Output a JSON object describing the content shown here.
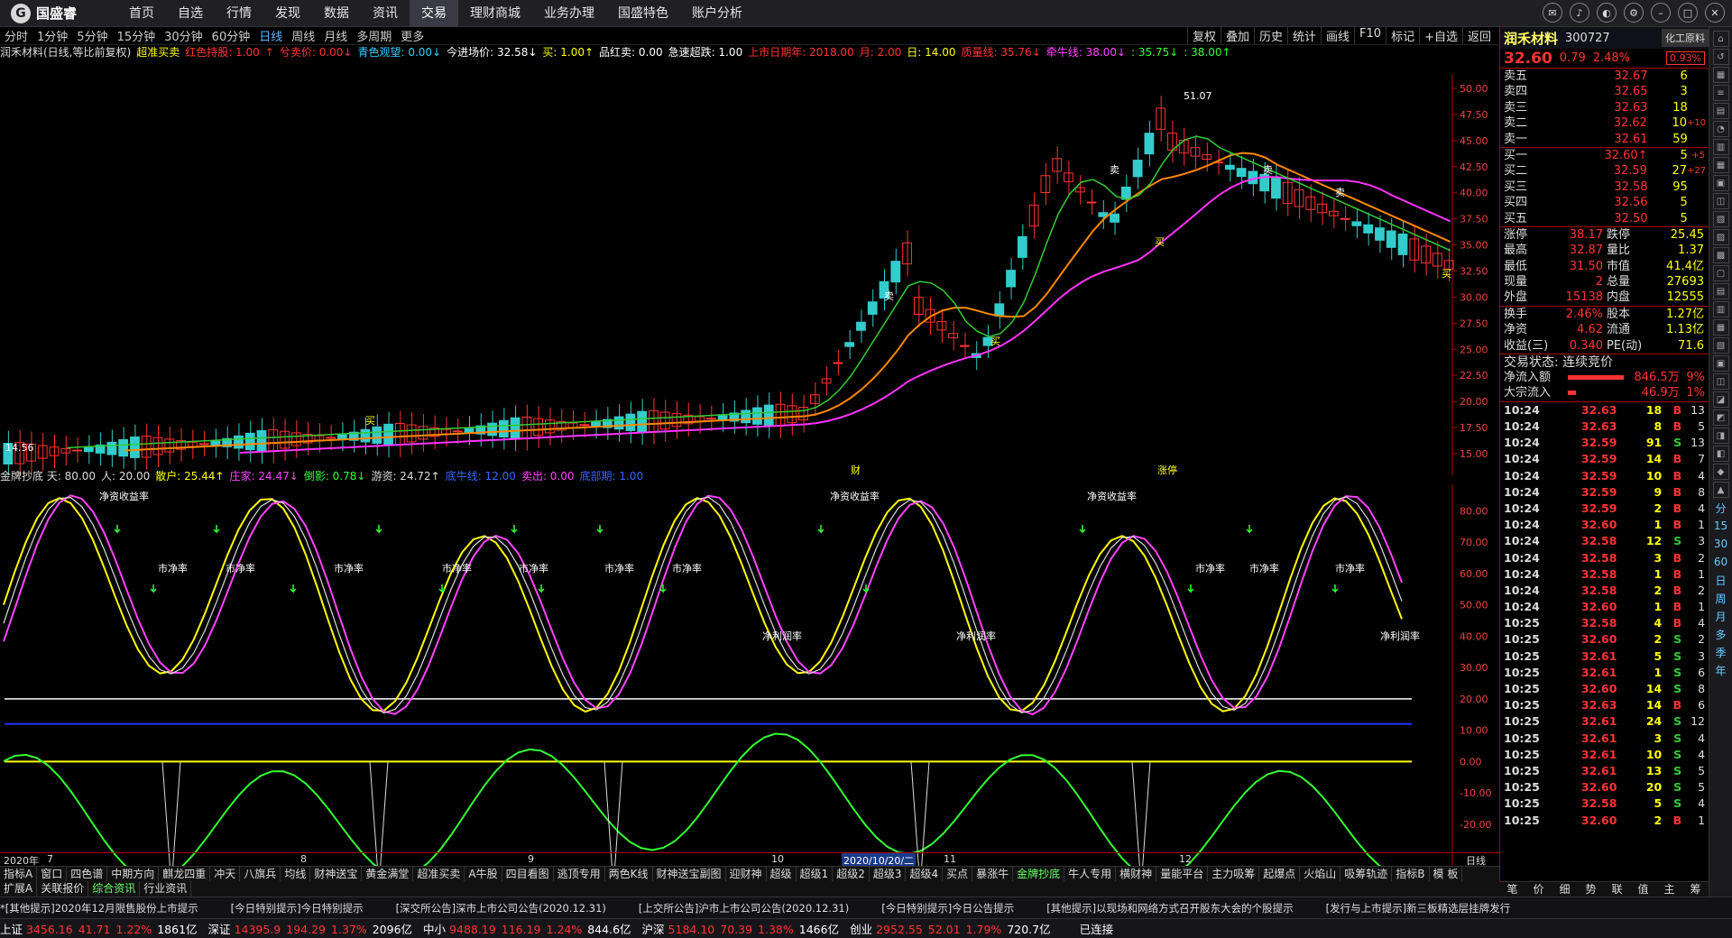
{
  "app": {
    "logo": "国盛睿",
    "nav": [
      "首页",
      "自选",
      "行情",
      "发现",
      "数据",
      "资讯",
      "交易",
      "理财商城",
      "业务办理",
      "国盛特色",
      "账户分析"
    ],
    "active_nav": "交易"
  },
  "periods": [
    "分时",
    "1分钟",
    "5分钟",
    "15分钟",
    "30分钟",
    "60分钟",
    "日线",
    "周线",
    "月线",
    "多周期",
    "更多"
  ],
  "active_period": "日线",
  "tools": [
    "复权",
    "叠加",
    "历史",
    "统计",
    "画线",
    "F10",
    "标记",
    "+自选",
    "返回"
  ],
  "main_indicator": {
    "title": "润禾材料(日线,等比前复权)",
    "name": "超准买卖",
    "items": [
      {
        "t": "红色持股: 1.00",
        "c": "#ff3333"
      },
      {
        "t": "↑",
        "c": "#ff3333"
      },
      {
        "t": "兮卖价: 0.00↓",
        "c": "#ff3333"
      },
      {
        "t": "青色观望: 0.00↓",
        "c": "#33ccff"
      },
      {
        "t": "今进场价: 32.58↓",
        "c": "#ffffff"
      },
      {
        "t": "买: 1.00↑",
        "c": "#ffff00"
      },
      {
        "t": "品红卖: 0.00",
        "c": "#ffffff"
      },
      {
        "t": "急速超跌: 1.00",
        "c": "#ffffff"
      },
      {
        "t": "上市日期年: 2018.00",
        "c": "#ff3333"
      },
      {
        "t": "月: 2.00",
        "c": "#ff3333"
      },
      {
        "t": "日: 14.00",
        "c": "#ffff00"
      },
      {
        "t": "质量线: 35.76↓",
        "c": "#ff3333"
      },
      {
        "t": "牵牛线: 38.00↓",
        "c": "#ff44ff"
      },
      {
        "t": ": 35.75↓",
        "c": "#33ff33"
      },
      {
        "t": ": 38.00↑",
        "c": "#33ff33"
      }
    ]
  },
  "sub_indicator": {
    "items": [
      {
        "t": "金牌抄底 天: 80.00",
        "c": "#dddddd"
      },
      {
        "t": "人: 20.00",
        "c": "#dddddd"
      },
      {
        "t": "散户: 25.44↑",
        "c": "#ffff00"
      },
      {
        "t": "庄家: 24.47↓",
        "c": "#ff44ff"
      },
      {
        "t": "倒影: 0.78↓",
        "c": "#33ff33"
      },
      {
        "t": "游资: 24.72↑",
        "c": "#dddddd"
      },
      {
        "t": "底牛线: 12.00",
        "c": "#3366ff"
      },
      {
        "t": "卖出: 0.00",
        "c": "#ff44ff"
      },
      {
        "t": "底部期: 1.00",
        "c": "#3366ff"
      }
    ]
  },
  "price_axis": [
    "50.00",
    "47.50",
    "45.00",
    "42.50",
    "40.00",
    "37.50",
    "35.00",
    "32.50",
    "30.00",
    "27.50",
    "25.00",
    "22.50",
    "20.00",
    "17.50",
    "15.00"
  ],
  "sub_axis": [
    "80.00",
    "70.00",
    "60.00",
    "50.00",
    "40.00",
    "30.00",
    "20.00",
    "10.00",
    "0.00",
    "-10.00",
    "-20.00"
  ],
  "annotations": {
    "high": "51.07",
    "low": "14.56",
    "cai": "财",
    "zhangting": "涨停",
    "label_jzc": "净资收益率",
    "label_sjl": "市净率",
    "label_jlr": "净利润率",
    "buy": "买",
    "sell": "卖"
  },
  "date_axis": {
    "year": "2020年",
    "months": [
      "7",
      "8",
      "9",
      "10",
      "11",
      "12"
    ],
    "highlight": "2020/10/20/二",
    "label": "日线"
  },
  "tabs1": [
    "指标A",
    "窗口",
    "四色谱",
    "中期方向",
    "麒龙四重",
    "冲天",
    "八旗兵",
    "均线",
    "财神送宝",
    "黄金满堂",
    "超准买卖",
    "A牛股",
    "四目看图",
    "逃顶专用",
    "两色K线",
    "财神送宝副图",
    "迎财神",
    "超级",
    "超级1",
    "超级2",
    "超级3",
    "超级4",
    "买点",
    "暴涨牛",
    "金牌抄底",
    "牛人专用",
    "横财神",
    "量能平台",
    "主力吸筹",
    "起爆点",
    "火焰山",
    "吸筹轨迹",
    "指标B",
    "模 板"
  ],
  "tabs1_active": "金牌抄底",
  "tabs2": [
    "扩展A",
    "关联报价",
    "综合资讯",
    "行业资讯"
  ],
  "tabs2_active": "综合资讯",
  "right_panel": {
    "name": "润禾材料",
    "code": "300727",
    "sector": "化工原料",
    "sector_pct": "0.93%",
    "price": "32.60",
    "change": "0.79",
    "pct": "2.48%",
    "asks": [
      {
        "k": "卖五",
        "p": "32.67",
        "q": "6",
        "d": ""
      },
      {
        "k": "卖四",
        "p": "32.65",
        "q": "3",
        "d": ""
      },
      {
        "k": "卖三",
        "p": "32.63",
        "q": "18",
        "d": ""
      },
      {
        "k": "卖二",
        "p": "32.62",
        "q": "10",
        "d": "+10"
      },
      {
        "k": "卖一",
        "p": "32.61",
        "q": "59",
        "d": ""
      }
    ],
    "bids": [
      {
        "k": "买一",
        "p": "32.60↑",
        "q": "5",
        "d": "+5"
      },
      {
        "k": "买二",
        "p": "32.59",
        "q": "27",
        "d": "+27"
      },
      {
        "k": "买三",
        "p": "32.58",
        "q": "95",
        "d": ""
      },
      {
        "k": "买四",
        "p": "32.56",
        "q": "5",
        "d": ""
      },
      {
        "k": "买五",
        "p": "32.50",
        "q": "5",
        "d": ""
      }
    ],
    "stats": [
      [
        "涨停",
        "38.17",
        "跌停",
        "25.45"
      ],
      [
        "最高",
        "32.87",
        "量比",
        "1.37"
      ],
      [
        "最低",
        "31.50",
        "市值",
        "41.4亿"
      ],
      [
        "现量",
        "2",
        "总量",
        "27693"
      ],
      [
        "外盘",
        "15138",
        "内盘",
        "12555"
      ]
    ],
    "stats2": [
      [
        "换手",
        "2.46%",
        "股本",
        "1.27亿"
      ],
      [
        "净资",
        "4.62",
        "流通",
        "1.13亿"
      ],
      [
        "收益(三)",
        "0.340",
        "PE(动)",
        "71.6"
      ]
    ],
    "state": "交易状态: 连续竞价",
    "flow": [
      {
        "k": "净流入额",
        "v": "846.5万",
        "p": "9%"
      },
      {
        "k": "大宗流入",
        "v": "46.9万",
        "p": "1%"
      }
    ],
    "ticks": [
      [
        "10:24",
        "32.63",
        "18",
        "B",
        "13"
      ],
      [
        "10:24",
        "32.63",
        "8",
        "B",
        "5"
      ],
      [
        "10:24",
        "32.59",
        "91",
        "S",
        "13"
      ],
      [
        "10:24",
        "32.59",
        "14",
        "B",
        "7"
      ],
      [
        "10:24",
        "32.59",
        "10",
        "B",
        "4"
      ],
      [
        "10:24",
        "32.59",
        "9",
        "B",
        "8"
      ],
      [
        "10:24",
        "32.59",
        "2",
        "B",
        "4"
      ],
      [
        "10:24",
        "32.60",
        "1",
        "B",
        "1"
      ],
      [
        "10:24",
        "32.58",
        "12",
        "S",
        "3"
      ],
      [
        "10:24",
        "32.58",
        "3",
        "B",
        "2"
      ],
      [
        "10:24",
        "32.58",
        "1",
        "B",
        "1"
      ],
      [
        "10:24",
        "32.58",
        "2",
        "B",
        "2"
      ],
      [
        "10:24",
        "32.60",
        "1",
        "B",
        "1"
      ],
      [
        "10:25",
        "32.58",
        "4",
        "B",
        "4"
      ],
      [
        "10:25",
        "32.60",
        "2",
        "S",
        "2"
      ],
      [
        "10:25",
        "32.61",
        "5",
        "S",
        "3"
      ],
      [
        "10:25",
        "32.61",
        "1",
        "S",
        "6"
      ],
      [
        "10:25",
        "32.60",
        "14",
        "S",
        "8"
      ],
      [
        "10:25",
        "32.63",
        "14",
        "B",
        "6"
      ],
      [
        "10:25",
        "32.61",
        "24",
        "S",
        "12"
      ],
      [
        "10:25",
        "32.61",
        "3",
        "S",
        "4"
      ],
      [
        "10:25",
        "32.61",
        "10",
        "S",
        "4"
      ],
      [
        "10:25",
        "32.61",
        "13",
        "S",
        "5"
      ],
      [
        "10:25",
        "32.60",
        "20",
        "S",
        "5"
      ],
      [
        "10:25",
        "32.58",
        "5",
        "S",
        "4"
      ],
      [
        "10:25",
        "32.60",
        "2",
        "B",
        "1"
      ]
    ],
    "tabs": [
      "笔",
      "价",
      "细",
      "势",
      "联",
      "值",
      "主",
      "筹"
    ]
  },
  "side_icons": [
    "⌂",
    "↺",
    "▦",
    "≡",
    "▤",
    "◔",
    "▥",
    "▦",
    "▣",
    "◫",
    "▧",
    "▨",
    "▩",
    "▢",
    "▤",
    "▥",
    "▦",
    "▧",
    "▣",
    "◫",
    "◪",
    "◩",
    "◨",
    "◧",
    "◆",
    "▲"
  ],
  "side_texts": [
    "分",
    "15",
    "30",
    "60",
    "日",
    "周",
    "月",
    "多",
    "季",
    "年"
  ],
  "ticker": [
    "*[其他提示]2020年12月限售股份上市提示",
    "[今日特别提示]今日特别提示",
    "[深交所公告]深市上市公司公告(2020.12.31)",
    "[上交所公告]沪市上市公司公告(2020.12.31)",
    "[今日特别提示]今日公告提示",
    "[其他提示]以现场和网络方式召开股东大会的个股提示",
    "[发行与上市提示]新三板精选层挂牌发行"
  ],
  "status": [
    {
      "l": "上证",
      "v": "3456.16",
      "c": "41.71",
      "p": "1.22%",
      "a": "1861亿"
    },
    {
      "l": "深证",
      "v": "14395.9",
      "c": "194.29",
      "p": "1.37%",
      "a": "2096亿"
    },
    {
      "l": "中小",
      "v": "9488.19",
      "c": "116.19",
      "p": "1.24%",
      "a": "844.6亿"
    },
    {
      "l": "沪深",
      "v": "5184.10",
      "c": "70.39",
      "p": "1.38%",
      "a": "1466亿"
    },
    {
      "l": "创业",
      "v": "2952.55",
      "c": "52.01",
      "p": "1.79%",
      "a": "720.7亿"
    }
  ],
  "conn": "已连接",
  "colors": {
    "up": "#ff3333",
    "down": "#33cccc",
    "ma1": "#ff8800",
    "ma2": "#ff33ff",
    "ma3": "#33cc33"
  }
}
